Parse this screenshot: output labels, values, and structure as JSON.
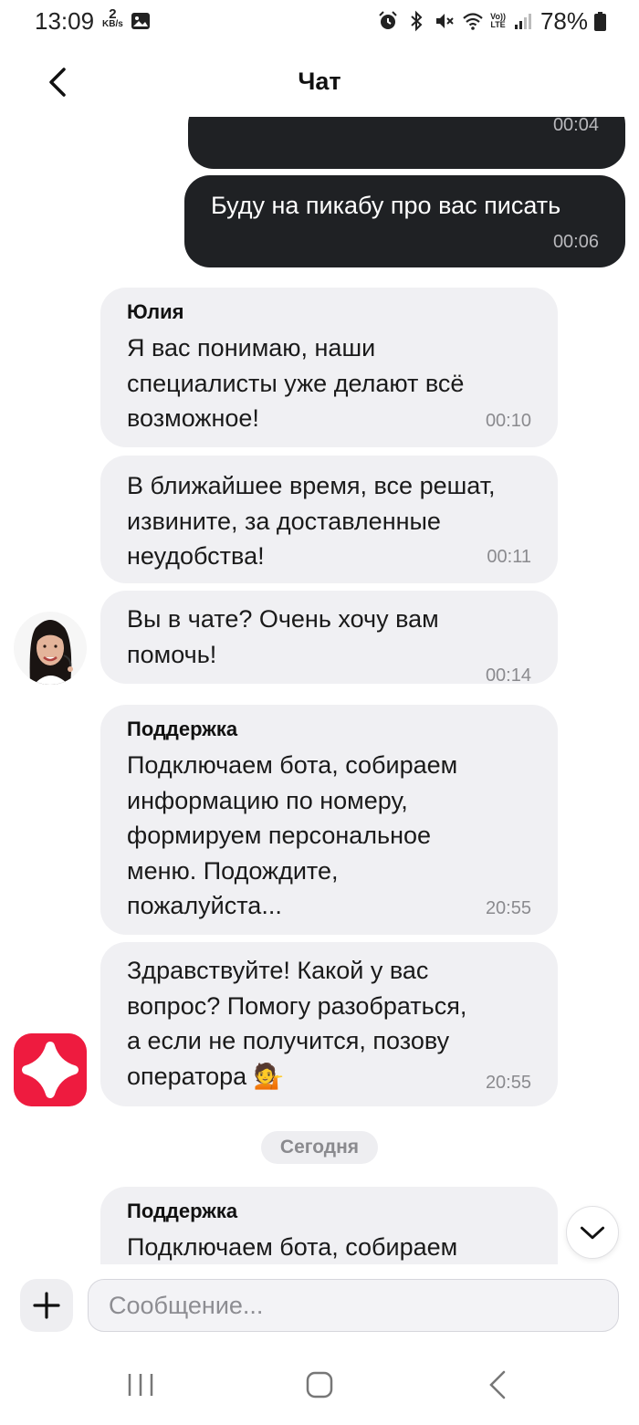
{
  "status_bar": {
    "time": "13:09",
    "speed_value": "2",
    "speed_unit": "KB/s",
    "lte_top": "Vo))",
    "lte_bottom": "LTE",
    "battery": "78%"
  },
  "header": {
    "title": "Чат"
  },
  "messages": [
    {
      "direction": "outgoing",
      "text": "",
      "time": "00:04"
    },
    {
      "direction": "outgoing",
      "text": "Буду на пикабу про вас писать",
      "time": "00:06"
    },
    {
      "direction": "incoming",
      "sender": "Юлия",
      "lines": [
        "Я вас понимаю, наши",
        "специалисты уже делают всё",
        "возможное!"
      ],
      "time": "00:10"
    },
    {
      "direction": "incoming",
      "lines": [
        "В ближайшее время, все решат,",
        "извините, за доставленные",
        "неудобства!"
      ],
      "time": "00:11"
    },
    {
      "direction": "incoming",
      "lines": [
        "Вы в чате? Очень хочу вам",
        "помочь!"
      ],
      "time": "00:14"
    },
    {
      "direction": "incoming",
      "sender": "Поддержка",
      "lines": [
        "Подключаем бота, собираем",
        "информацию по номеру,",
        "формируем персональное",
        "меню. Подождите,",
        "пожалуйста..."
      ],
      "time": "20:55"
    },
    {
      "direction": "incoming",
      "lines": [
        "Здравствуйте! Какой у вас",
        "вопрос? Помогу разобраться,",
        "а если не получится, позову",
        "оператора 💁"
      ],
      "time": "20:55"
    },
    {
      "direction": "incoming",
      "sender": "Поддержка",
      "lines": [
        "Подключаем бота, собираем"
      ]
    }
  ],
  "date_divider": "Сегодня",
  "composer": {
    "placeholder": "Сообщение..."
  },
  "icons": {
    "back": "chevron-left-icon",
    "scroll": "chevron-down-icon",
    "attach": "plus-icon",
    "bot": "bot-logo-icon"
  },
  "colors": {
    "outgoing_bubble": "#1f2124",
    "incoming_bubble": "#f0f0f3",
    "bot_brand": "#ee1b3f"
  }
}
